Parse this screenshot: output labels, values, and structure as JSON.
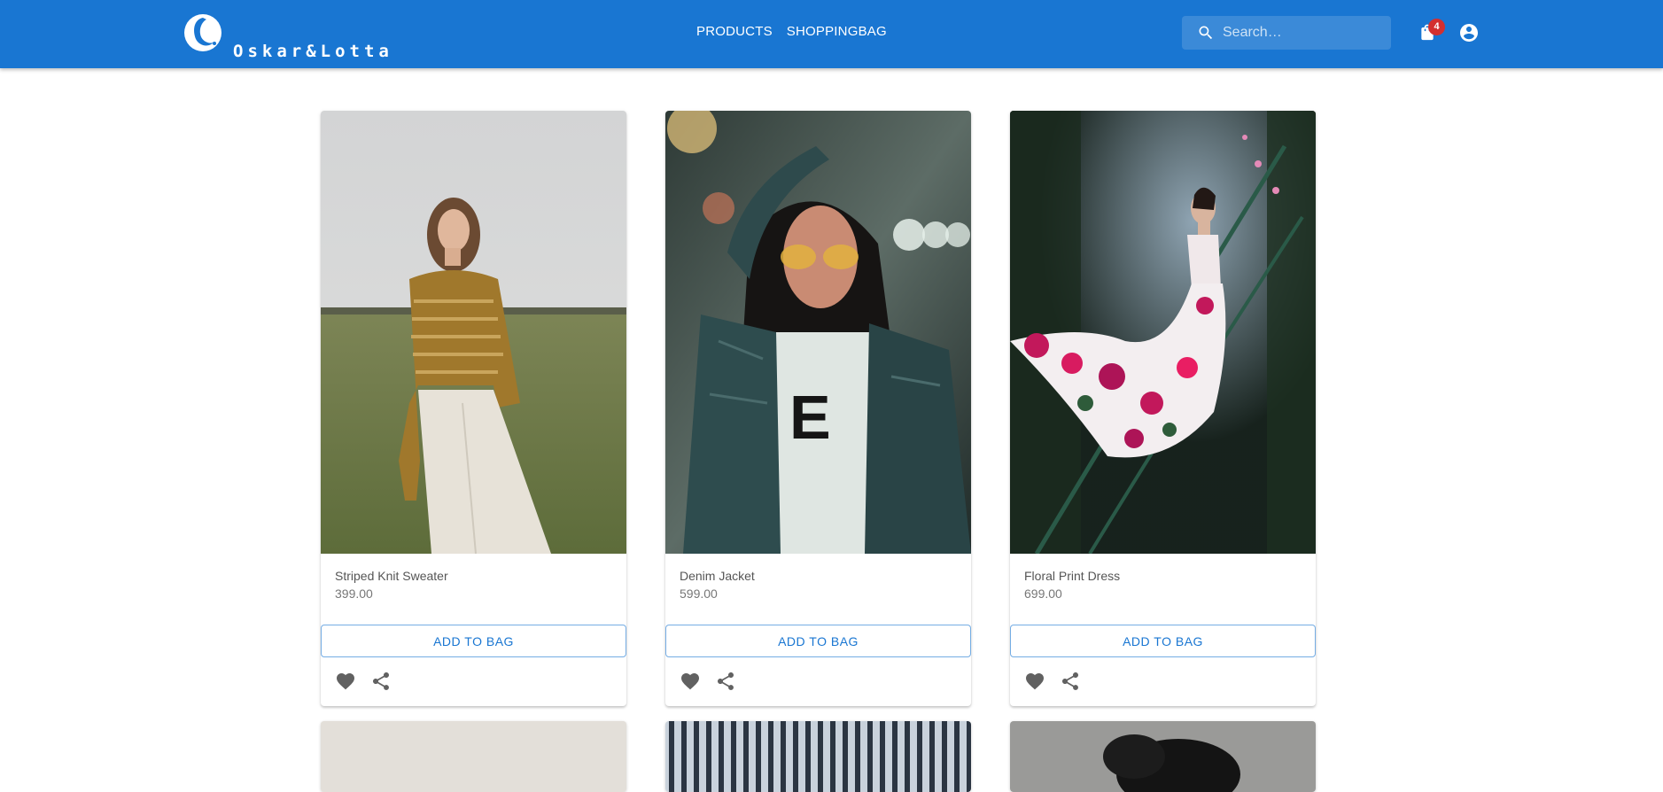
{
  "brand": {
    "name": "Oskar&Lotta"
  },
  "nav": {
    "products": "PRODUCTS",
    "shoppingbag": "SHOPPINGBAG"
  },
  "search": {
    "placeholder": "Search…"
  },
  "bag": {
    "count": "4",
    "icon": "shopping-bag-icon"
  },
  "account": {
    "icon": "account-circle-icon"
  },
  "colors": {
    "primary": "#1976d2",
    "badge": "#d32f2f"
  },
  "products": [
    {
      "name": "Striped Knit Sweater",
      "price": "399.00",
      "button": "ADD TO BAG"
    },
    {
      "name": "Denim Jacket",
      "price": "599.00",
      "button": "ADD TO BAG"
    },
    {
      "name": "Floral Print Dress",
      "price": "699.00",
      "button": "ADD TO BAG"
    }
  ]
}
